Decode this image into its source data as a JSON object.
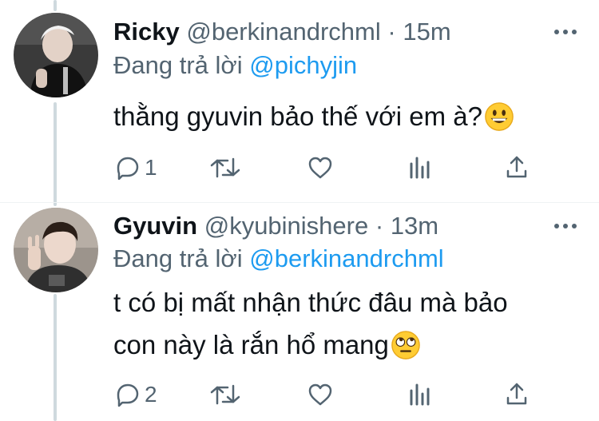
{
  "tweets": [
    {
      "name": "Ricky",
      "handle": "@berkinandrchml",
      "separator": "·",
      "time": "15m",
      "reply_prefix": "Đang trả lời",
      "reply_to": "@pichyjin",
      "text": "thằng gyuvin bảo thế với em à?",
      "emoji": "grinning-face-emoji",
      "reply_count": "1",
      "retweet_count": "",
      "like_count": ""
    },
    {
      "name": "Gyuvin",
      "handle": "@kyubinishere",
      "separator": "·",
      "time": "13m",
      "reply_prefix": "Đang trả lời",
      "reply_to": "@berkinandrchml",
      "text_line1": "t có bị mất nhận thức đâu mà bảo",
      "text_line2": "con này là rắn hổ mang",
      "emoji": "face-with-rolling-eyes-emoji",
      "reply_count": "2",
      "retweet_count": "",
      "like_count": ""
    }
  ],
  "icons": {
    "reply": "reply-icon",
    "retweet": "retweet-icon",
    "like": "heart-icon",
    "analytics": "analytics-icon",
    "share": "share-icon",
    "more": "more-icon"
  },
  "colors": {
    "text": "#0f1419",
    "secondary": "#536471",
    "link": "#1d9bf0",
    "thread_line": "#cfd9de",
    "background": "#ffffff"
  }
}
